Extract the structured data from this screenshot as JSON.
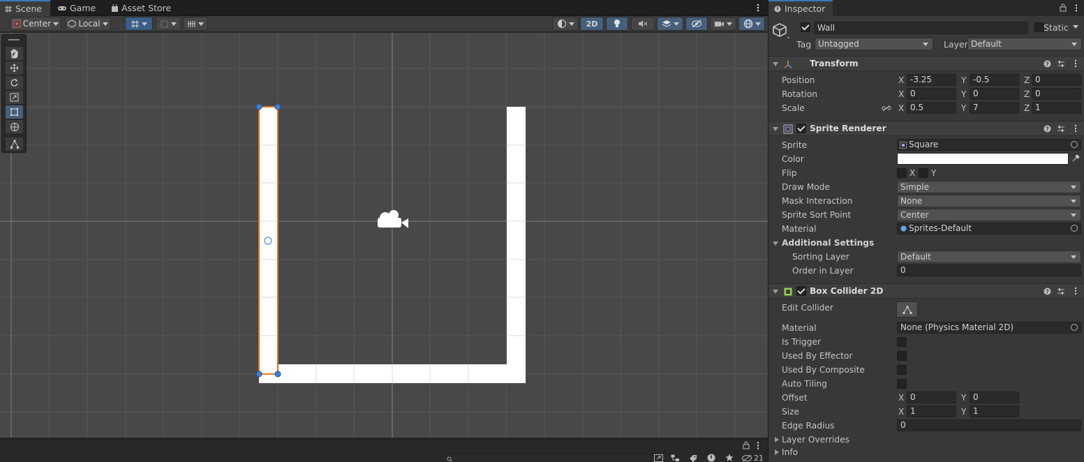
{
  "scene_tabs": [
    {
      "label": "Scene",
      "active": true
    },
    {
      "label": "Game",
      "active": false
    },
    {
      "label": "Asset Store",
      "active": false
    }
  ],
  "scene_toolbar": {
    "pivot_mode": "Center",
    "pivot_rotation": "Local",
    "mode_2d": "2D"
  },
  "bottom_bar": {
    "hidden_count": "21"
  },
  "inspector": {
    "tab_label": "Inspector",
    "object_name": "Wall",
    "static_label": "Static",
    "tag_label": "Tag",
    "tag_value": "Untagged",
    "layer_label": "Layer",
    "layer_value": "Default",
    "transform": {
      "title": "Transform",
      "position_label": "Position",
      "rotation_label": "Rotation",
      "scale_label": "Scale",
      "position": {
        "x": "-3.25",
        "y": "-0.5",
        "z": "0"
      },
      "rotation": {
        "x": "0",
        "y": "0",
        "z": "0"
      },
      "scale": {
        "x": "0.5",
        "y": "7",
        "z": "1"
      }
    },
    "sprite_renderer": {
      "title": "Sprite Renderer",
      "sprite_label": "Sprite",
      "sprite_value": "Square",
      "color_label": "Color",
      "color_value": "#ffffff",
      "flip_label": "Flip",
      "flip_x": "X",
      "flip_y": "Y",
      "draw_mode_label": "Draw Mode",
      "draw_mode_value": "Simple",
      "mask_label": "Mask Interaction",
      "mask_value": "None",
      "sort_point_label": "Sprite Sort Point",
      "sort_point_value": "Center",
      "material_label": "Material",
      "material_value": "Sprites-Default",
      "additional_label": "Additional Settings",
      "sorting_layer_label": "Sorting Layer",
      "sorting_layer_value": "Default",
      "order_label": "Order in Layer",
      "order_value": "0"
    },
    "box_collider": {
      "title": "Box Collider 2D",
      "edit_collider_label": "Edit Collider",
      "material_label": "Material",
      "material_value": "None (Physics Material 2D)",
      "is_trigger_label": "Is Trigger",
      "used_by_effector_label": "Used By Effector",
      "used_by_composite_label": "Used By Composite",
      "auto_tiling_label": "Auto Tiling",
      "offset_label": "Offset",
      "offset": {
        "x": "0",
        "y": "0"
      },
      "size_label": "Size",
      "size": {
        "x": "1",
        "y": "1"
      },
      "edge_radius_label": "Edge Radius",
      "edge_radius_value": "0",
      "layer_overrides_label": "Layer Overrides",
      "info_label": "Info"
    },
    "axis_x": "X",
    "axis_y": "Y",
    "axis_z": "Z"
  },
  "colors": {
    "selection_outline": "#e8701a",
    "handle": "#3a80d8",
    "accent": "#3a79bb"
  }
}
